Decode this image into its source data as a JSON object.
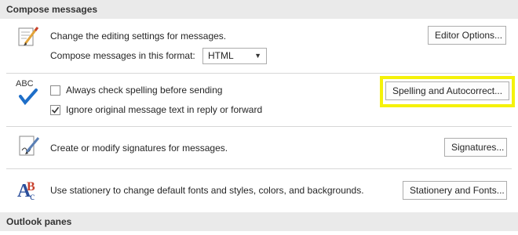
{
  "sections": {
    "compose": "Compose messages",
    "outlook_panes": "Outlook panes"
  },
  "editing": {
    "description": "Change the editing settings for messages.",
    "button": "Editor Options...",
    "format_label": "Compose messages in this format:",
    "format_value": "HTML"
  },
  "spelling": {
    "icon_text": "ABC",
    "always_check": "Always check spelling before sending",
    "always_check_checked": false,
    "ignore_original": "Ignore original message text in reply or forward",
    "ignore_original_checked": true,
    "button": "Spelling and Autocorrect..."
  },
  "signatures": {
    "description": "Create or modify signatures for messages.",
    "button": "Signatures..."
  },
  "stationery": {
    "description": "Use stationery to change default fonts and styles, colors, and backgrounds.",
    "button": "Stationery and Fonts..."
  },
  "colors": {
    "highlight": "#f5f20a",
    "check_blue": "#1e6ec8",
    "header_bg": "#eaeaea"
  }
}
